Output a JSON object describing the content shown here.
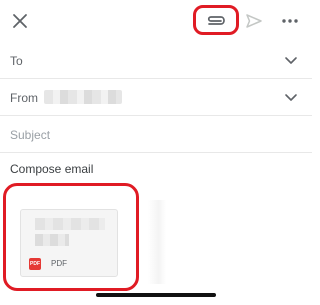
{
  "toolbar": {
    "close_icon": "close-icon",
    "attach_icon": "paperclip-icon",
    "send_icon": "send-icon",
    "more_icon": "more-options-icon",
    "highlight_color": "#e01b24"
  },
  "fields": {
    "to_label": "To",
    "from_label": "From",
    "subject_placeholder": "Subject",
    "compose_placeholder": "Compose email"
  },
  "attachment": {
    "type_label": "PDF",
    "type_icon": "pdf-icon",
    "pdf_color": "#e53935"
  },
  "colors": {
    "background": "#ffffff",
    "highlight": "#e01b24"
  }
}
